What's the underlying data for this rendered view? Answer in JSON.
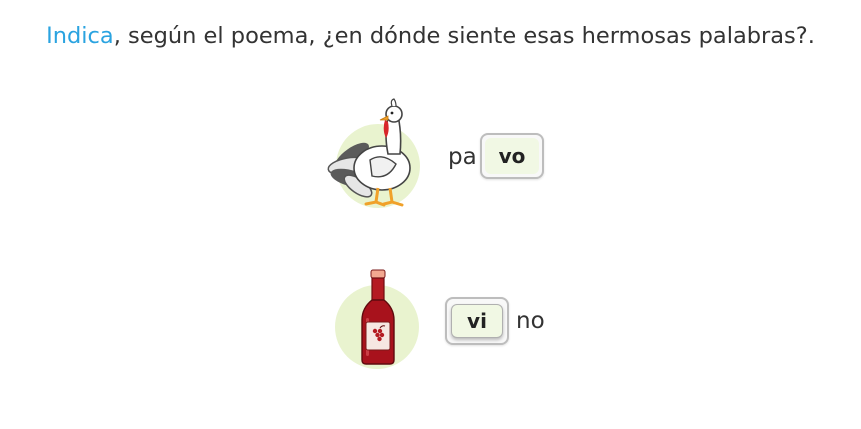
{
  "question": {
    "verb": "Indica",
    "rest": ", según el poema, ¿en dónde siente esas hermosas palabras?."
  },
  "items": [
    {
      "image_icon": "turkey-icon",
      "syllable_text": "pa",
      "tile_text": "vo"
    },
    {
      "image_icon": "wine-bottle-icon",
      "tile_text": "vi",
      "syllable_text": "no"
    }
  ],
  "colors": {
    "accent": "#2aa3e0",
    "circle": "#e9f3cf",
    "tile": "#f1f8e4",
    "wine": "#a8121c"
  }
}
